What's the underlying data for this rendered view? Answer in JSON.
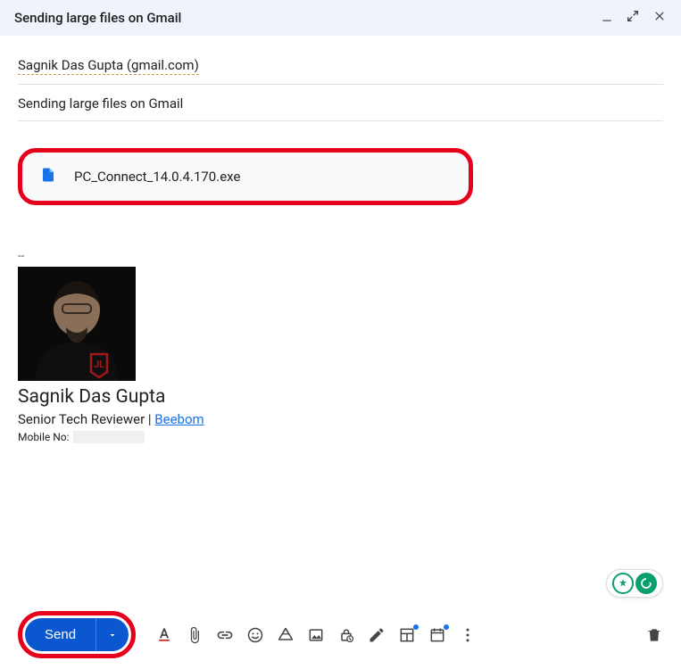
{
  "header": {
    "title": "Sending large files on Gmail"
  },
  "recipient": {
    "name": "Sagnik Das Gupta (gmail.com)"
  },
  "subject": "Sending large files on Gmail",
  "attachment": {
    "filename": "PC_Connect_14.0.4.170.exe"
  },
  "signature": {
    "separator": "--",
    "name": "Sagnik Das Gupta",
    "role": "Senior Tech Reviewer",
    "divider": "|",
    "company": "Beebom",
    "mobile_label": "Mobile No:"
  },
  "toolbar": {
    "send_label": "Send"
  },
  "colors": {
    "primary": "#0b57d0",
    "link": "#1a73e8",
    "highlight_border": "#e6001c"
  }
}
